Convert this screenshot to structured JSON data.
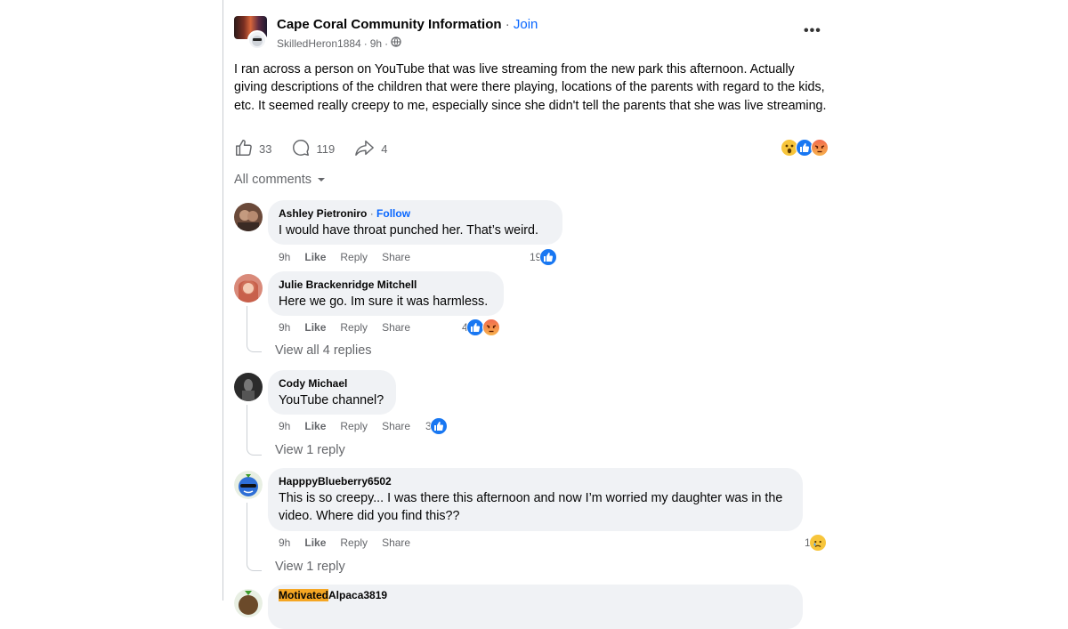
{
  "post": {
    "group_name": "Cape Coral Community Information",
    "separator": " · ",
    "join_label": "Join",
    "author": "SkilledHeron1884",
    "age": "9h",
    "dot": "·",
    "more_label": "•••",
    "text": "I ran across a person on YouTube that was live streaming from the new park this afternoon. Actually giving descriptions of the children that were there playing, locations of the parents with regard to the kids, etc. It seemed really creepy to me, especially since she didn't tell the parents that she was live streaming.",
    "like_count": "33",
    "comment_count": "119",
    "share_count": "4",
    "reactions": [
      "wow",
      "like",
      "angry"
    ]
  },
  "comments_header": {
    "label": "All comments"
  },
  "comments": [
    {
      "name": "Ashley Pietroniro",
      "follow": "Follow",
      "text": "I would have throat punched her. That’s weird.",
      "age": "9h",
      "like": "Like",
      "reply": "Reply",
      "share": "Share",
      "reaction_count": "19",
      "reactions": [
        "like"
      ]
    },
    {
      "name": "Julie Brackenridge Mitchell",
      "text": "Here we go. Im sure it was harmless.",
      "age": "9h",
      "like": "Like",
      "reply": "Reply",
      "share": "Share",
      "reaction_count": "4",
      "reactions": [
        "like",
        "angry"
      ],
      "view_replies": "View all 4 replies"
    },
    {
      "name": "Cody Michael",
      "text": "YouTube channel?",
      "age": "9h",
      "like": "Like",
      "reply": "Reply",
      "share": "Share",
      "reaction_count": "3",
      "reactions": [
        "like"
      ],
      "view_replies": "View 1 reply"
    },
    {
      "name": "HapppyBlueberry6502",
      "text": "This is so creepy... I was there this afternoon and now I’m worried my daughter was in the video. Where did you find this??",
      "age": "9h",
      "like": "Like",
      "reply": "Reply",
      "share": "Share",
      "reaction_count": "1",
      "reactions": [
        "sad"
      ],
      "view_replies": "View 1 reply"
    },
    {
      "name_highlight": "Motivated",
      "name_rest": "Alpaca3819"
    }
  ],
  "colors": {
    "link": "#0866ff",
    "secondary": "#65676b",
    "bubble": "#f0f2f5",
    "like": "#1877f2"
  }
}
